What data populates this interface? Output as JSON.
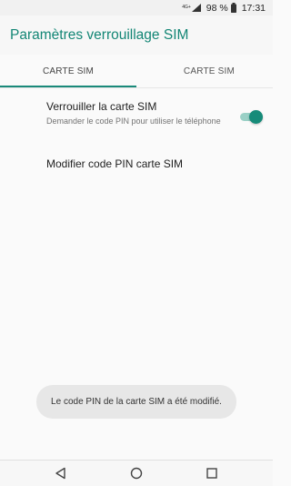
{
  "status_bar": {
    "network_label": "4G+",
    "battery_percent": "98 %",
    "time": "17:31"
  },
  "app_bar": {
    "title": "Paramètres verrouillage SIM",
    "accent_color": "#138675"
  },
  "tabs": [
    {
      "label": "CARTE SIM",
      "selected": true
    },
    {
      "label": "CARTE SIM",
      "selected": false
    }
  ],
  "settings": {
    "lock_sim": {
      "title": "Verrouiller la carte SIM",
      "summary": "Demander le code PIN pour utiliser le téléphone",
      "enabled": true
    },
    "change_pin": {
      "title": "Modifier code PIN carte SIM"
    }
  },
  "toast": {
    "message": "Le code PIN de la carte SIM a été modifié."
  },
  "nav_bar": {
    "icons": [
      "back-icon",
      "home-icon",
      "recents-icon"
    ]
  }
}
